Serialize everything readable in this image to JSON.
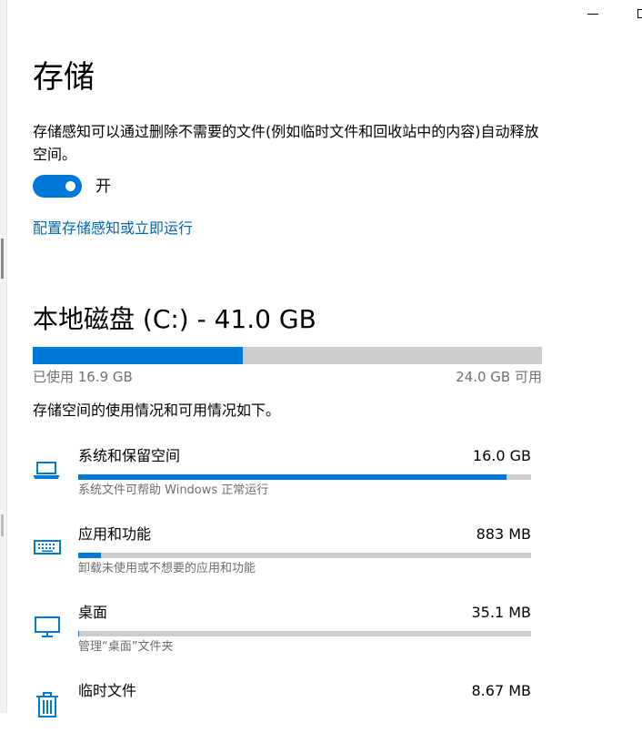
{
  "window": {
    "minimize_label": "",
    "maximize_label": ""
  },
  "page": {
    "title": "存储"
  },
  "storage_sense": {
    "description": "存储感知可以通过删除不需要的文件(例如临时文件和回收站中的内容)自动释放空间。",
    "toggle_state": "开",
    "toggle_on": true,
    "config_link": "配置存储感知或立即运行"
  },
  "drive": {
    "title": "本地磁盘 (C:) - 41.0 GB",
    "used_label": "已使用 16.9 GB",
    "free_label": "24.0 GB 可用",
    "used_fraction": 0.412
  },
  "usage_intro": "存储空间的使用情况和可用情况如下。",
  "categories": [
    {
      "name": "系统和保留空间",
      "size": "16.0 GB",
      "desc": "系统文件可帮助 Windows 正常运行",
      "fraction": 0.945,
      "icon": "laptop-icon"
    },
    {
      "name": "应用和功能",
      "size": "883 MB",
      "desc": "卸载未使用或不想要的应用和功能",
      "fraction": 0.05,
      "icon": "keyboard-icon"
    },
    {
      "name": "桌面",
      "size": "35.1 MB",
      "desc": "管理“桌面”文件夹",
      "fraction": 0.003,
      "icon": "monitor-icon"
    },
    {
      "name": "临时文件",
      "size": "8.67 MB",
      "desc": "",
      "fraction": 0.0,
      "icon": "trash-icon"
    }
  ],
  "colors": {
    "accent": "#0078d7",
    "link": "#0066b4",
    "track": "#cccccc",
    "secondary_text": "#707070"
  }
}
